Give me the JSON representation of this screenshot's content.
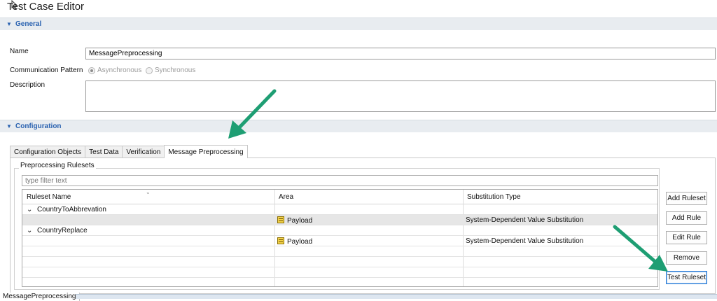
{
  "window": {
    "title": "Test Case Editor"
  },
  "general": {
    "section_label": "General",
    "name_label": "Name",
    "name_value": "MessagePreprocessing",
    "comm_label": "Communication Pattern",
    "radio_async": "Asynchronous",
    "radio_sync": "Synchronous",
    "selected_pattern": "Asynchronous",
    "description_label": "Description",
    "description_value": ""
  },
  "configuration": {
    "section_label": "Configuration",
    "tabs": [
      {
        "label": "Configuration Objects"
      },
      {
        "label": "Test Data"
      },
      {
        "label": "Verification"
      },
      {
        "label": "Message Preprocessing"
      }
    ],
    "active_tab": "Message Preprocessing",
    "group_title": "Preprocessing Rulesets",
    "filter_placeholder": "type filter text",
    "columns": [
      "Ruleset Name",
      "Area",
      "Substitution Type"
    ],
    "rows": [
      {
        "ruleset": "CountryToAbbrevation",
        "area": "",
        "substitution": ""
      },
      {
        "ruleset": "",
        "area": "Payload",
        "substitution": "System-Dependent Value Substitution"
      },
      {
        "ruleset": "CountryReplace",
        "area": "",
        "substitution": ""
      },
      {
        "ruleset": "",
        "area": "Payload",
        "substitution": "System-Dependent Value Substitution"
      }
    ],
    "buttons": {
      "add_ruleset": "Add Ruleset",
      "add_rule": "Add Rule",
      "edit_rule": "Edit Rule",
      "remove": "Remove",
      "test_ruleset": "Test Ruleset"
    }
  },
  "footer": {
    "tab_label": "MessagePreprocessing"
  },
  "colors": {
    "section_header": "#2a62b0",
    "section_bg": "#e8ecf0",
    "arrow": "#1e9e73",
    "focus": "#2a7bd5"
  }
}
